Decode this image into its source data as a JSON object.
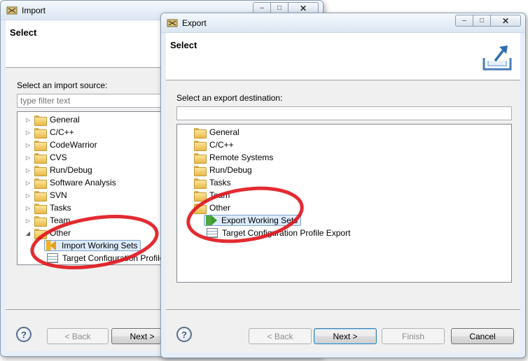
{
  "import_dialog": {
    "title": "Import",
    "header_title": "Select",
    "prompt": "Select an import source:",
    "filter_placeholder": "type filter text",
    "tree": [
      {
        "label": "General",
        "expanded": false
      },
      {
        "label": "C/C++",
        "expanded": false
      },
      {
        "label": "CodeWarrior",
        "expanded": false
      },
      {
        "label": "CVS",
        "expanded": false
      },
      {
        "label": "Run/Debug",
        "expanded": false
      },
      {
        "label": "Software Analysis",
        "expanded": false
      },
      {
        "label": "SVN",
        "expanded": false
      },
      {
        "label": "Tasks",
        "expanded": false
      },
      {
        "label": "Team",
        "expanded": false
      },
      {
        "label": "Other",
        "expanded": true
      }
    ],
    "children": [
      {
        "label": "Import Working Sets",
        "icon": "import-working-sets-icon",
        "selected": true
      },
      {
        "label": "Target Configuration Profile",
        "icon": "target-configuration-icon",
        "selected": false
      }
    ],
    "buttons": {
      "back": "< Back",
      "next": "Next >"
    }
  },
  "export_dialog": {
    "title": "Export",
    "header_title": "Select",
    "header_icon": "export-wizard-icon",
    "prompt": "Select an export destination:",
    "filter_value": "",
    "tree": [
      {
        "label": "General"
      },
      {
        "label": "C/C++"
      },
      {
        "label": "Remote Systems"
      },
      {
        "label": "Run/Debug"
      },
      {
        "label": "Tasks"
      },
      {
        "label": "Team"
      },
      {
        "label": "Other"
      }
    ],
    "children": [
      {
        "label": "Export Working Sets",
        "icon": "export-working-sets-icon",
        "selected": true
      },
      {
        "label": "Target Configuration Profile Export",
        "icon": "target-configuration-icon",
        "selected": false
      }
    ],
    "buttons": {
      "back": "< Back",
      "next": "Next >",
      "finish": "Finish",
      "cancel": "Cancel"
    }
  },
  "annotation_color": "#e0141b"
}
